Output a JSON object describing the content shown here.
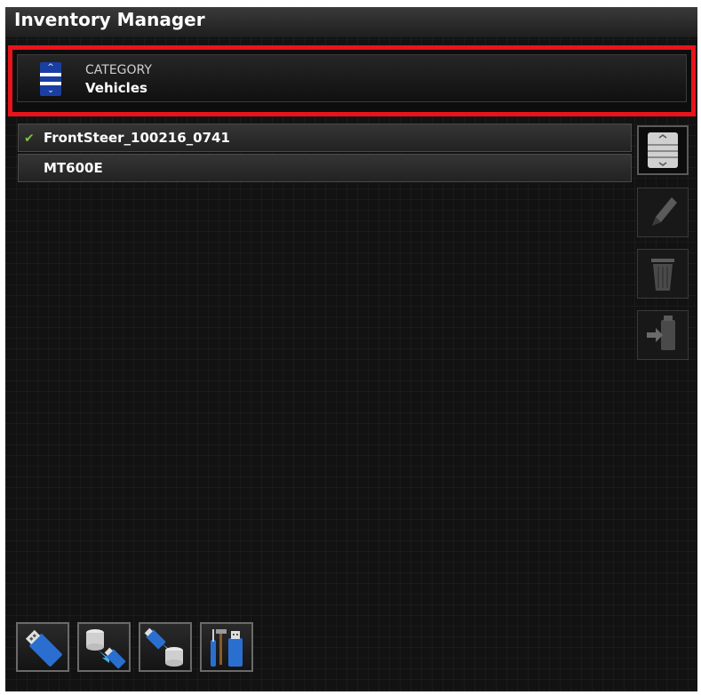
{
  "app": {
    "title": "Inventory Manager"
  },
  "category": {
    "label": "CATEGORY",
    "value": "Vehicles"
  },
  "items": [
    {
      "label": "FrontSteer_100216_0741",
      "selected": true
    },
    {
      "label": "MT600E",
      "selected": false
    }
  ],
  "colors": {
    "highlight": "#e8141a",
    "accent_blue": "#1a3fa3",
    "check": "#7cc043"
  },
  "side_buttons": [
    "scroll-icon",
    "pencil-icon",
    "trash-icon",
    "usb-export-icon"
  ],
  "bottom_buttons": [
    "usb-icon",
    "database-to-usb-icon",
    "usb-to-database-icon",
    "tools-usb-icon"
  ]
}
